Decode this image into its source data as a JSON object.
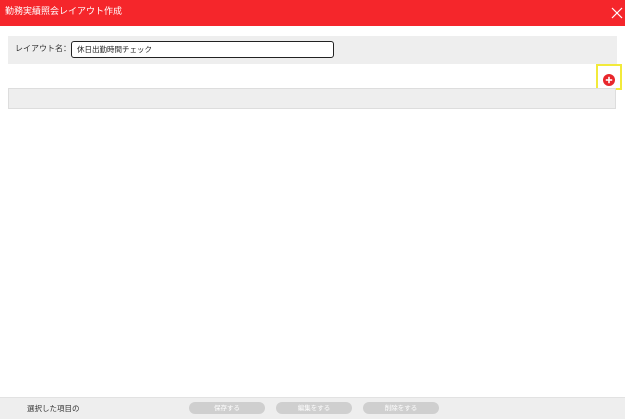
{
  "window": {
    "title": "勤務実績照会レイアウト作成",
    "close_icon": "close-icon",
    "accent_color": "#f5262b"
  },
  "layout_name": {
    "label": "レイアウト名：",
    "value": "休日出勤時間チェック"
  },
  "add_button": {
    "icon": "plus-circle-icon",
    "color": "#e8262b",
    "highlight_color": "#f2ea3b"
  },
  "footer": {
    "selected_label": "選択した項目の",
    "save_label": "保存する",
    "edit_label": "編集をする",
    "delete_label": "削除をする"
  }
}
